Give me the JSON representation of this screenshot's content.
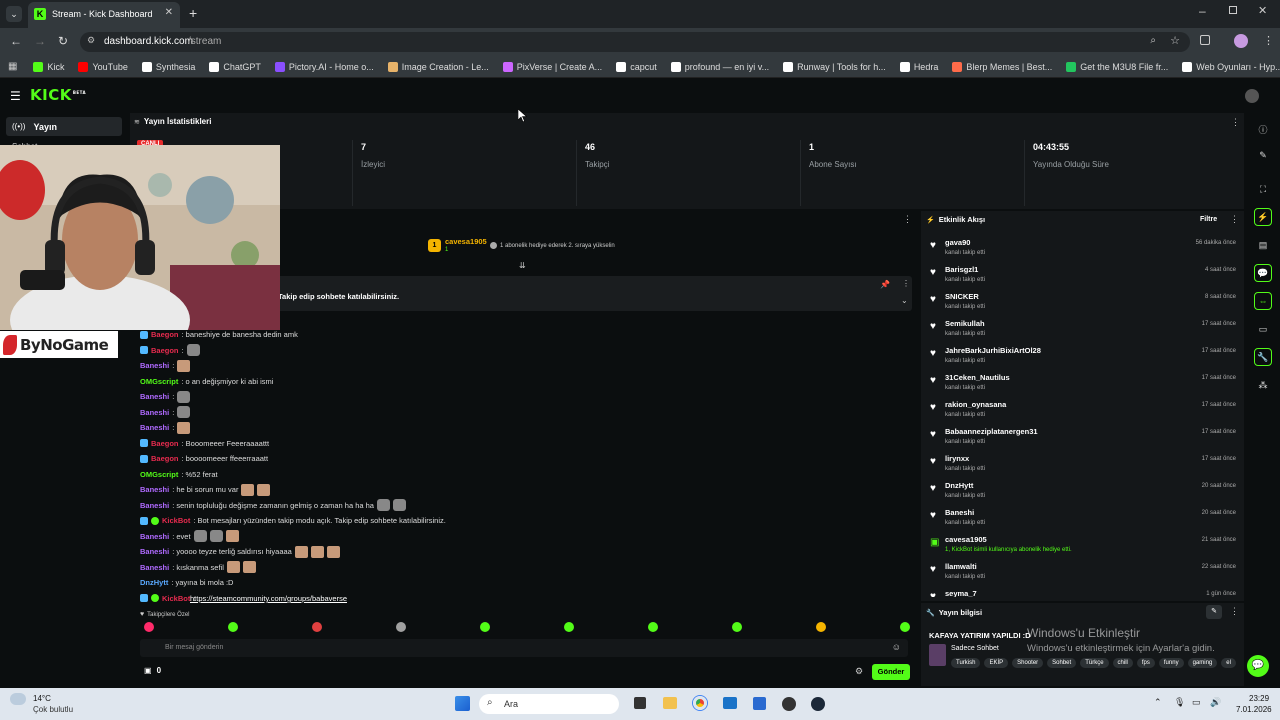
{
  "browser": {
    "tab_title": "Stream - Kick Dashboard",
    "url_host": "dashboard.kick.com",
    "url_path": "/stream",
    "bookmarks": [
      "Kick",
      "YouTube",
      "Synthesia",
      "ChatGPT",
      "Pictory.AI - Home o...",
      "Image Creation - Le...",
      "PixVerse | Create A...",
      "capcut",
      "profound — en iyi v...",
      "Runway | Tools for h...",
      "Hedra",
      "Blerp Memes | Best...",
      "Get the M3U8 File fr...",
      "Web Oyunları - Hyp..."
    ]
  },
  "kick": {
    "logo": "KICK",
    "logo_sup": "BETA",
    "sidebar": {
      "active": "Yayın",
      "second": "Sohbet"
    },
    "stats": {
      "title": "Yayın İstatistikleri",
      "live_badge": "CANLI",
      "items": [
        {
          "value": "7",
          "label": "İzleyici"
        },
        {
          "value": "46",
          "label": "Takipçi"
        },
        {
          "value": "1",
          "label": "Abone Sayısı"
        },
        {
          "value": "04:43:55",
          "label": "Yayında Olduğu Süre"
        }
      ]
    },
    "leaderboard": {
      "user": "cavesa1905",
      "rank": "1",
      "hint": "1 abonelik hediye ederek 2. sıraya yükselin"
    },
    "pinned": "Takip edip sohbete katılabilirsiniz.",
    "chat": [
      {
        "user": "Baegon",
        "color": "#e62b4e",
        "text": ": baneshiye de banesha dedin amk"
      },
      {
        "user": "Baegon",
        "color": "#e62b4e",
        "text": ":"
      },
      {
        "user": "Baneshi",
        "color": "#b06aff",
        "text": ":"
      },
      {
        "user": "OMGscript",
        "color": "#53fc18",
        "text": ": o an değişmiyor ki abi ismi"
      },
      {
        "user": "Baneshi",
        "color": "#b06aff",
        "text": ":"
      },
      {
        "user": "Baneshi",
        "color": "#b06aff",
        "text": ":"
      },
      {
        "user": "Baneshi",
        "color": "#b06aff",
        "text": ":"
      },
      {
        "user": "Baegon",
        "color": "#e62b4e",
        "text": ": Booomeeer Feeeraaaattt"
      },
      {
        "user": "Baegon",
        "color": "#e62b4e",
        "text": ": boooomeeer ffeeerraaatt"
      },
      {
        "user": "OMGscript",
        "color": "#53fc18",
        "text": ": %52 ferat"
      },
      {
        "user": "Baneshi",
        "color": "#b06aff",
        "text": ": he bi sorun mu var"
      },
      {
        "user": "Baneshi",
        "color": "#b06aff",
        "text": ": senin topluluğu değişme zamanın gelmiş o zaman ha ha ha"
      },
      {
        "user": "KickBot",
        "color": "#e62b4e",
        "text": ": Bot mesajları yüzünden takip modu açık. Takip edip sohbete katılabilirsiniz."
      },
      {
        "user": "Baneshi",
        "color": "#b06aff",
        "text": ": evet"
      },
      {
        "user": "Baneshi",
        "color": "#b06aff",
        "text": ": yoooo teyze terliğ saldırısı hiyaaaa"
      },
      {
        "user": "Baneshi",
        "color": "#b06aff",
        "text": ": kıskanma sefil"
      },
      {
        "user": "DnzHytt",
        "color": "#5aa9ff",
        "text": ": yayına bi mola :D"
      },
      {
        "user": "KickBot",
        "color": "#e62b4e",
        "text": ":"
      }
    ],
    "chat_link": "https://steamcommunity.com/groups/babaverse",
    "followers_only": "Takipçilere Özel",
    "message_placeholder": "Bir mesaj gönderin",
    "points": "0",
    "send": "Gönder",
    "activity": {
      "title": "Etkinlik Akışı",
      "filter": "Filtre",
      "items": [
        {
          "name": "gava90",
          "sub": "kanalı takip etti",
          "time": "56 dakika önce"
        },
        {
          "name": "Barisgzl1",
          "sub": "kanalı takip etti",
          "time": "4 saat önce"
        },
        {
          "name": "SNICKER",
          "sub": "kanalı takip etti",
          "time": "8 saat önce"
        },
        {
          "name": "Semikullah",
          "sub": "kanalı takip etti",
          "time": "17 saat önce"
        },
        {
          "name": "JahreBarkJurhiBixiArtOl28",
          "sub": "kanalı takip etti",
          "time": "17 saat önce"
        },
        {
          "name": "31Ceken_Nautilus",
          "sub": "kanalı takip etti",
          "time": "17 saat önce"
        },
        {
          "name": "rakion_oynasana",
          "sub": "kanalı takip etti",
          "time": "17 saat önce"
        },
        {
          "name": "Babaanneziplatanergen31",
          "sub": "kanalı takip etti",
          "time": "17 saat önce"
        },
        {
          "name": "lirynxx",
          "sub": "kanalı takip etti",
          "time": "17 saat önce"
        },
        {
          "name": "DnzHytt",
          "sub": "kanalı takip etti",
          "time": "20 saat önce"
        },
        {
          "name": "Baneshi",
          "sub": "kanalı takip etti",
          "time": "20 saat önce"
        },
        {
          "name": "cavesa1905",
          "sub": "1, KickBot isimli kullanıcıya abonelik hediye etti.",
          "time": "21 saat önce"
        },
        {
          "name": "llamwalti",
          "sub": "kanalı takip etti",
          "time": "22 saat önce"
        },
        {
          "name": "seyma_7",
          "sub": "",
          "time": "1 gün önce"
        }
      ]
    },
    "info": {
      "title": "Yayın bilgisi",
      "stream_title": "KAFAYA YATIRIM YAPILDI :D",
      "category": "Sadece Sohbet",
      "tags": [
        "Turkish",
        "EKİP",
        "Shooter",
        "Sohbet",
        "Türkçe",
        "chill",
        "fps",
        "funny",
        "gaming",
        "el"
      ]
    }
  },
  "overlay": {
    "activation_title": "Windows'u Etkinleştir",
    "activation_sub": "Windows'u etkinleştirmek için Ayarlar'a gidin.",
    "webcam_brand": "ByNoGame"
  },
  "taskbar": {
    "temp": "14°C",
    "weather": "Çok bulutlu",
    "search": "Ara",
    "time": "23:29",
    "date": "7.01.2026"
  }
}
